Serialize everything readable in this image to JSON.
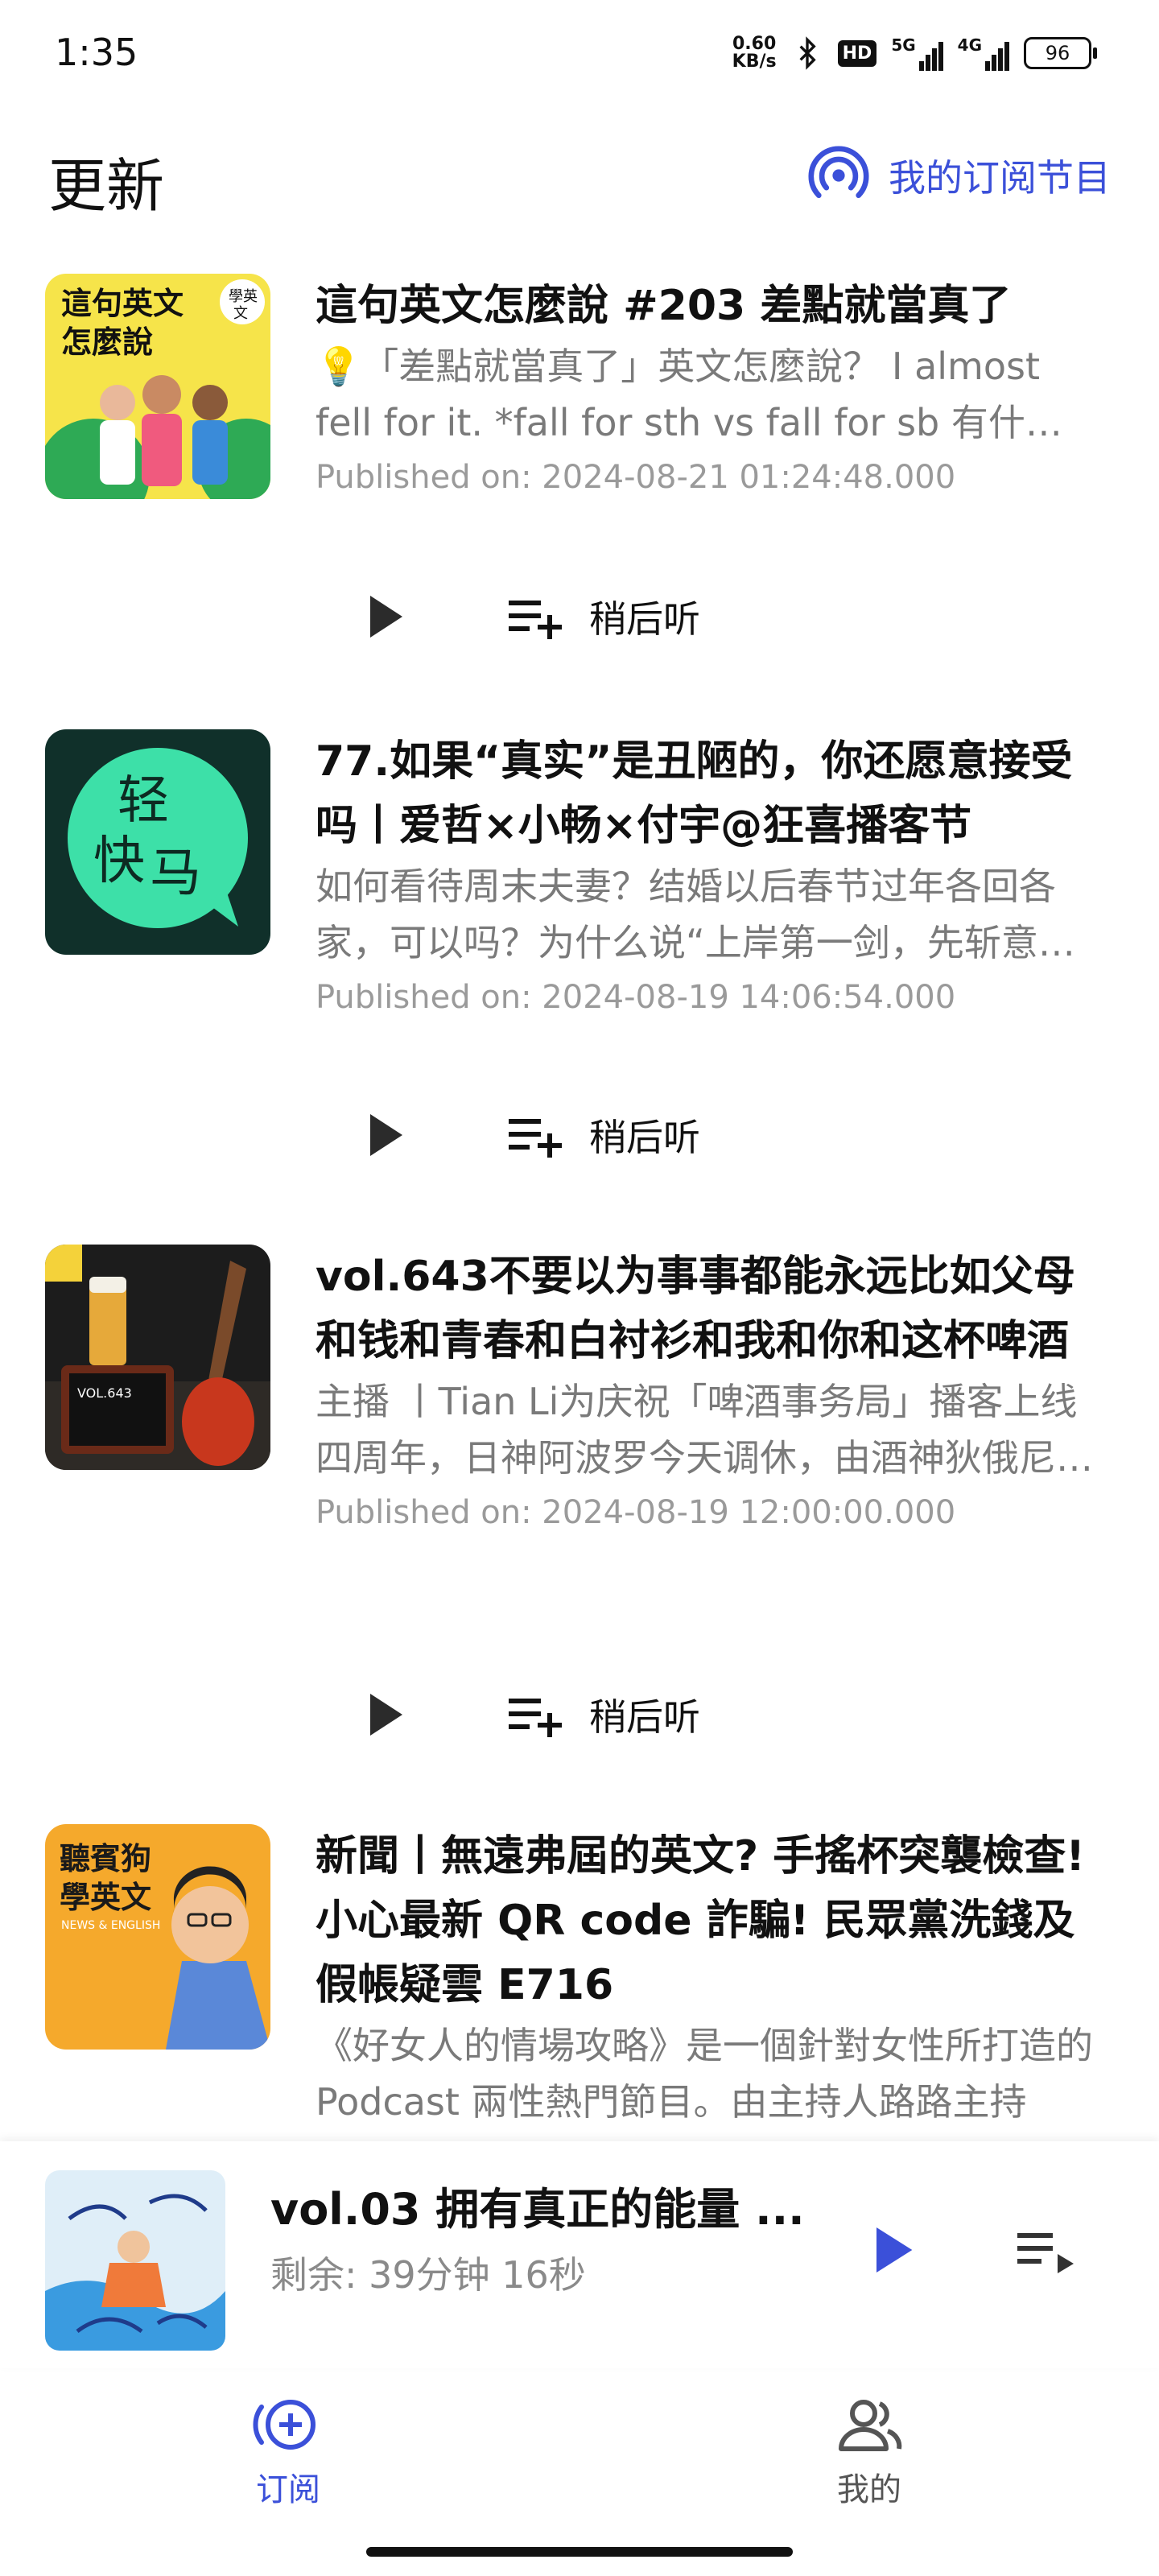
{
  "status_bar": {
    "time": "1:35",
    "net_speed_value": "0.60",
    "net_speed_unit": "KB/s",
    "hd_label": "HD",
    "network_1": "5G",
    "network_2": "4G",
    "battery": "96"
  },
  "header": {
    "title": "更新",
    "my_subscriptions": "我的订阅节目"
  },
  "episodes": [
    {
      "title": "這句英文怎麼說 #203 差點就當真了",
      "description": "💡「差點就當真了」英文怎麼說？ I almost fell for it. *fall for sth vs fall for sb 有什麼差別",
      "published": "Published on: 2024-08-21 01:24:48.000",
      "later_label": "稍后听",
      "cover_text": [
        "這句英文",
        "怎麼說",
        "學英",
        "文"
      ],
      "cover_color": "#f6e44a"
    },
    {
      "title": "77.如果“真实”是丑陋的，你还愿意接受吗丨爱哲×小畅×付宇@狂喜播客节",
      "description": "如何看待周末夫妻？结婚以后春节过年各回各家，可以吗？为什么说“上岸第一剑，先斩意中人”",
      "published": "Published on: 2024-08-19 14:06:54.000",
      "later_label": "稍后听",
      "cover_text": [
        "轻",
        "快",
        "马"
      ],
      "cover_color": "#3de0a8"
    },
    {
      "title": "vol.643不要以为事事都能永远比如父母和钱和青春和白衬衫和我和你和这杯啤酒",
      "description": "主播 丨Tian Li为庆祝「啤酒事务局」播客上线四周年，日神阿波罗今天调休，由酒神狄俄尼索斯",
      "published": "Published on: 2024-08-19 12:00:00.000",
      "later_label": "稍后听",
      "cover_text": [
        "VOL.643"
      ],
      "cover_color": "#1c1c1c"
    },
    {
      "title": "新聞丨無遠弗屆的英文? 手搖杯突襲檢查! 小心最新 QR code 詐騙! 民眾黨洗錢及假帳疑雲 E716",
      "description": "《好女人的情場攻略》是一個針對女性所打造的 Podcast 兩性熱門節目。由主持人路路主持",
      "cover_text": [
        "聽賓狗",
        "學英文",
        "NEWS & ENGLISH"
      ],
      "cover_color": "#f5a92c"
    }
  ],
  "mini_player": {
    "title": "vol.03 拥有真正的能量 ...",
    "remaining": "剩余: 39分钟 16秒"
  },
  "bottom_nav": {
    "subscriptions": "订阅",
    "me": "我的"
  },
  "colors": {
    "accent": "#3b50d9"
  }
}
